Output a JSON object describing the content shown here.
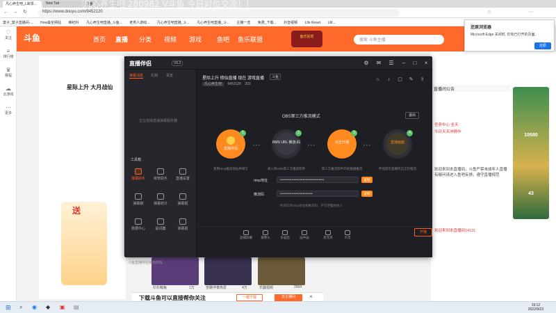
{
  "browser": {
    "tabs": [
      "凡心养生吧_L来领...",
      "New Tab",
      "斗鱼"
    ],
    "overlay_text": "凡心养生吧 280982 V斗鱼 今日对位交流！！",
    "url": "https://www.douyu.com/9452120",
    "bookmarks": [
      "莫子_莫子直播间-...",
      "How最全网站",
      "维纪科",
      "凡心养生吧直播_斗鱼...",
      "老男人游戏...",
      "凡心养生吧直播_斗...",
      "凡心养生吧直播_斗...",
      "主播一览",
      "免费_下载...",
      "抖音视频",
      "Life Reset",
      "LM..."
    ]
  },
  "rail": [
    "关注",
    "排行榜",
    "赛程",
    "云游戏",
    "更多"
  ],
  "site": {
    "logo": "斗鱼",
    "nav": [
      "首页",
      "直播",
      "分类",
      "视频",
      "游戏",
      "鱼吧",
      "鱼乐联盟"
    ],
    "search_placeholder": "搜索 斗鱼主播",
    "banner": "鱼乐狂欢"
  },
  "stream": {
    "title": "星际上升 大月战仙",
    "promo_text": "送"
  },
  "thumbs": [
    {
      "caption": "杉杉萌兔",
      "count": "1万"
    },
    {
      "caption": "苦路伴奏热爱",
      "count": "4万"
    },
    {
      "caption": "乐器视频",
      "count": "2994"
    }
  ],
  "right": {
    "header": "直播间公告",
    "lines": [
      "欢迎来到本直播间，斗鱼严禁未成年人直播",
      "有疑问请进入鱼吧反馈，遵守直播规范",
      "任务中心 全天",
      "今日天天冲榜中",
      "欢迎来到本直播间14131"
    ],
    "ad_numbers": [
      "10580",
      "43"
    ]
  },
  "bottom_ad": {
    "text": "下载斗鱼可以直接帮你关注",
    "btn1": "一键下载",
    "btn2": "去主播间"
  },
  "notif": {
    "title": "还原浏览器",
    "message": "Microsoft Edge 关闭时, 仍有已打开的页面。",
    "button": "还原"
  },
  "taskbar": {
    "time": "19:12",
    "date": "2022/9/23"
  },
  "app": {
    "logo": "直播伴侣",
    "version": "V6.2",
    "side_tabs": [
      "弹幕消息",
      "礼物",
      "贵宾"
    ],
    "danmu_placeholder": "正在连接直播弹幕服务器",
    "tools_label": "工具箱",
    "tools": [
      {
        "label": "弹幕助手",
        "on": true
      },
      {
        "label": "房管助手",
        "on": false
      },
      {
        "label": "直播设置",
        "on": false
      },
      {
        "label": "弹幕聊",
        "on": false
      },
      {
        "label": "弹幕统计",
        "on": false
      },
      {
        "label": "弹幕姬",
        "on": false
      },
      {
        "label": "数据中心",
        "on": false
      },
      {
        "label": "提词器",
        "on": false
      },
      {
        "label": "弹幕姬",
        "on": false
      }
    ],
    "side_bottom": "斗鱼直播伴侣使用教程",
    "room_title": "星际上升 修仙直播 现在 游戏直播",
    "room_badge": "斗鱼",
    "room_chips": [
      "凡心养生吧",
      "9452120",
      "203"
    ],
    "mode_title": "OBS第三方推流模式",
    "exit": "退出",
    "steps": [
      {
        "label": "直播伴侣",
        "num": "1",
        "desc": "复制rtmp推流地址并填写",
        "orange": true
      },
      {
        "label": "RMS URL 推流-码",
        "num": "2",
        "desc": "填入到OBS第三方推流软件",
        "orange": false
      },
      {
        "label": "点击开播",
        "num": "3",
        "desc": "第三方推流软件开始直播推流",
        "orange": true
      },
      {
        "label": "直播画面",
        "num": "4",
        "desc": "伴侣提示直播开启正在推流",
        "orange": false
      }
    ],
    "rtmp_label": "rtmp地址",
    "rtmp_value": "•••••••••••••••••••••••••••••••",
    "key_label": "推流码",
    "key_value": "•••••••••••••••••••••••",
    "copy": "复制",
    "hint": "所填写的rtmp地址和推流码，不可泄露给他人",
    "toolbar": [
      "直播屏幕",
      "摄像头",
      "多画面",
      "画中画",
      "麦克风",
      "声音"
    ],
    "start": "开播"
  }
}
